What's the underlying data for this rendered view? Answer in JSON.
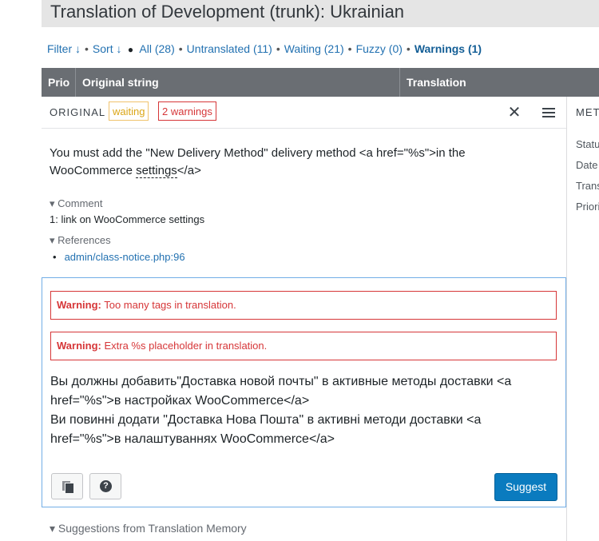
{
  "header": {
    "title": "Translation of Development (trunk): Ukrainian"
  },
  "filters": {
    "filter": "Filter ↓",
    "sort": "Sort ↓",
    "all": "All (28)",
    "untranslated": "Untranslated (11)",
    "waiting": "Waiting (21)",
    "fuzzy": "Fuzzy (0)",
    "warnings": "Warnings (1)"
  },
  "table": {
    "columns": [
      "Prio",
      "Original string",
      "Translation"
    ]
  },
  "editor": {
    "original_label": "ORIGINAL",
    "status_badge": "waiting",
    "warnings_badge": "2 warnings",
    "original_text_before": "You must add the \"New Delivery Method\" delivery method <a href=\"%s\">in the WooCommerce ",
    "original_text_dotted": "settings",
    "original_text_after": "</a>",
    "comment_toggle": "Comment",
    "comment_text": "1: link on WooCommerce settings",
    "references_toggle": "References",
    "references": [
      "admin/class-notice.php:96"
    ],
    "warnings": [
      {
        "label": "Warning:",
        "text": "Too many tags in translation."
      },
      {
        "label": "Warning:",
        "text": "Extra %s placeholder in translation."
      }
    ],
    "translation_lines": [
      "Вы должны добавить\"Доставка новой почты\" в активные методы доставки <a href=\"%s\">в настройках WooCommerce</a>",
      "Ви повинні додати \"Доставка Нова Пошта\" в активні методи доставки <a href=\"%s\">в налаштуваннях WooCommerce</a>"
    ],
    "suggest_label": "Suggest",
    "tm_toggle": "Suggestions from Translation Memory"
  },
  "meta": {
    "title": "META",
    "labels": [
      "Status",
      "Date",
      "Translated by",
      "Priority"
    ]
  }
}
